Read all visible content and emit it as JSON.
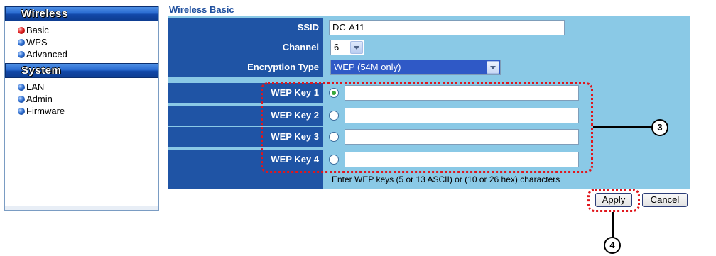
{
  "sidebar": {
    "sections": [
      {
        "title": "Wireless",
        "items": [
          {
            "label": "Basic",
            "active": true
          },
          {
            "label": "WPS",
            "active": false
          },
          {
            "label": "Advanced",
            "active": false
          }
        ]
      },
      {
        "title": "System",
        "items": [
          {
            "label": "LAN",
            "active": false
          },
          {
            "label": "Admin",
            "active": false
          },
          {
            "label": "Firmware",
            "active": false
          }
        ]
      }
    ]
  },
  "page": {
    "title": "Wireless Basic"
  },
  "form": {
    "ssid": {
      "label": "SSID",
      "value": "DC-A11"
    },
    "channel": {
      "label": "Channel",
      "value": "6"
    },
    "encryption": {
      "label": "Encryption Type",
      "value": "WEP (54M only)"
    },
    "wep_keys": [
      {
        "label": "WEP Key 1",
        "value": "",
        "selected": true
      },
      {
        "label": "WEP Key 2",
        "value": "",
        "selected": false
      },
      {
        "label": "WEP Key 3",
        "value": "",
        "selected": false
      },
      {
        "label": "WEP Key 4",
        "value": "",
        "selected": false
      }
    ],
    "hint": "Enter WEP keys (5 or 13 ASCII) or (10 or 26 hex) characters"
  },
  "buttons": {
    "apply": "Apply",
    "cancel": "Cancel"
  },
  "callouts": {
    "wep_keys": "3",
    "apply": "4"
  },
  "colors": {
    "accent": "#1f54a5",
    "panel": "#8ac9e6",
    "highlight": "#e0161c"
  }
}
